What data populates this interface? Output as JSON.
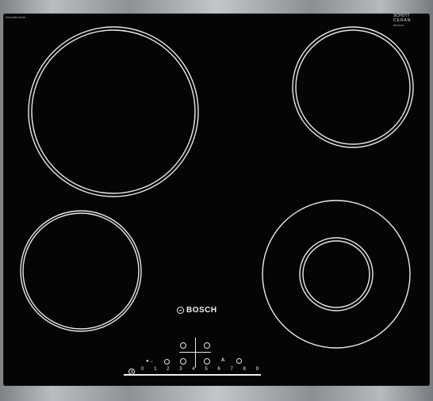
{
  "cooktop": {
    "model_code": "PKF645B17E/05",
    "glass_brand": "SCHOTT",
    "glass_line": "CERAN",
    "glass_sub": "DE/SN/20",
    "brand": "BOSCH"
  },
  "controls": {
    "slider_digits": [
      "0",
      "1",
      "2",
      "3",
      "4",
      "5",
      "6",
      "7",
      "8",
      "9"
    ],
    "auto_label": "A",
    "timer_icon": "timer-icon",
    "lock_icon": "child-lock-icon",
    "power_icon": "power-icon"
  },
  "colors": {
    "glass": "#050505",
    "frame": "#a9aeb2",
    "markings": "#e8e8e8"
  }
}
